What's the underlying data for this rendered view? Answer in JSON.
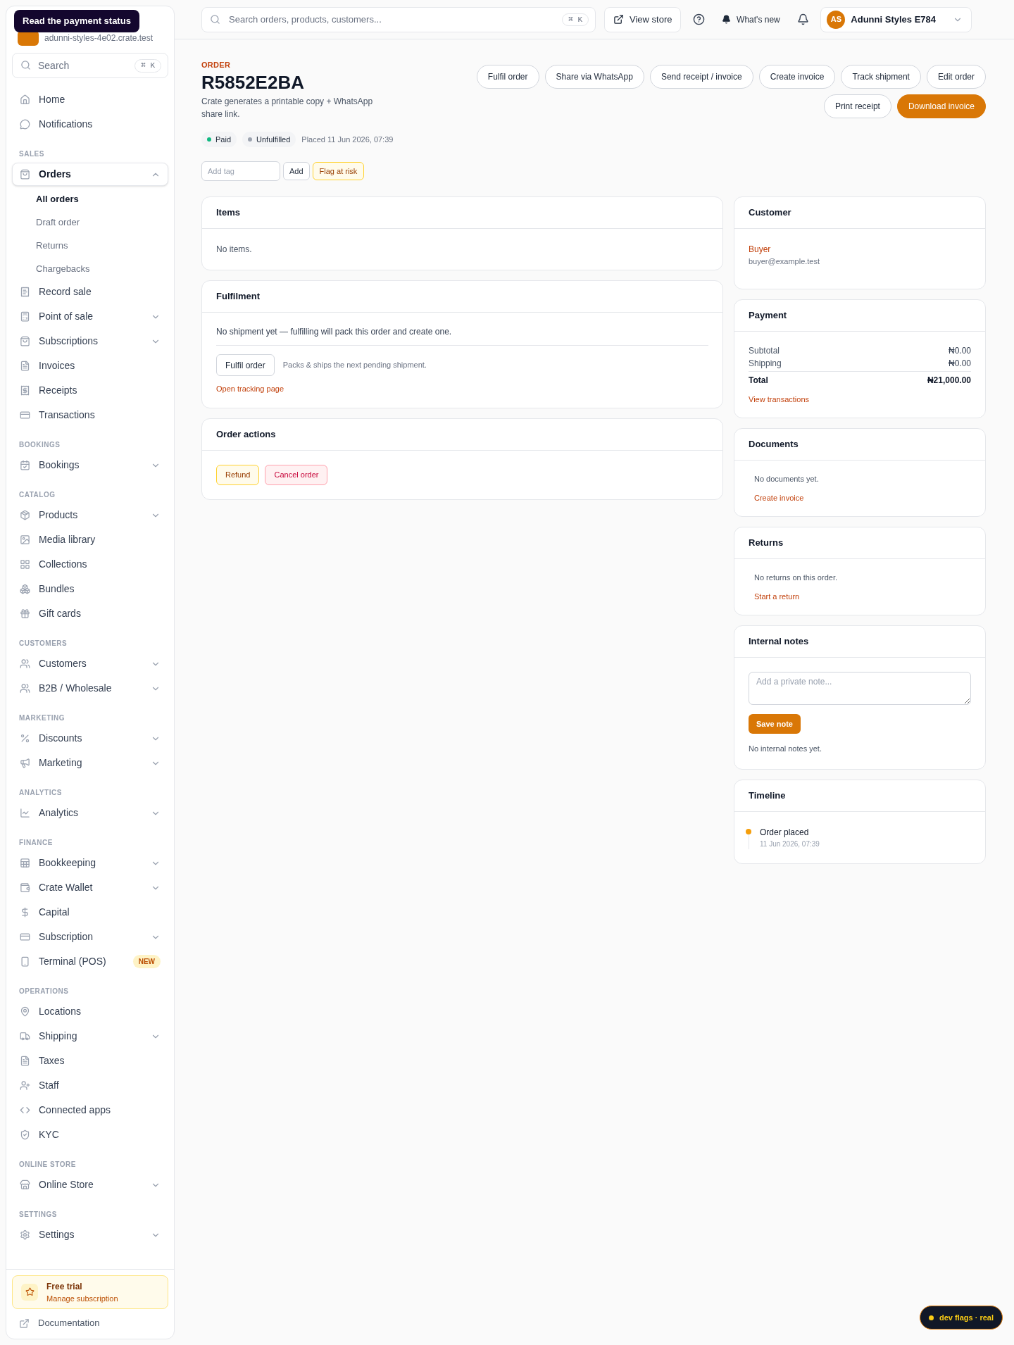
{
  "tooltip": {
    "text": "Read the payment status"
  },
  "sidebar": {
    "store_domain": "adunni-styles-4e02.crate.test",
    "search": {
      "placeholder": "Search",
      "shortcut": "⌘ K"
    },
    "sections": [
      {
        "items": [
          {
            "label": "Home",
            "selected": false
          },
          {
            "label": "Notifications",
            "selected": false
          }
        ]
      },
      {
        "label": "SALES",
        "items": [
          {
            "label": "Orders",
            "selected": true,
            "expanded": true,
            "children": [
              {
                "label": "All orders",
                "selected": true
              },
              {
                "label": "Draft order",
                "selected": false
              },
              {
                "label": "Returns",
                "selected": false
              },
              {
                "label": "Chargebacks",
                "selected": false
              }
            ]
          },
          {
            "label": "Record sale",
            "selected": false
          },
          {
            "label": "Point of sale",
            "selected": false,
            "expanded": false
          },
          {
            "label": "Subscriptions",
            "selected": false,
            "expanded": false
          },
          {
            "label": "Invoices",
            "selected": false
          },
          {
            "label": "Receipts",
            "selected": false
          },
          {
            "label": "Transactions",
            "selected": false
          }
        ]
      },
      {
        "label": "BOOKINGS",
        "items": [
          {
            "label": "Bookings",
            "selected": false,
            "expanded": false
          }
        ]
      },
      {
        "label": "CATALOG",
        "items": [
          {
            "label": "Products",
            "selected": false,
            "expanded": false
          },
          {
            "label": "Media library",
            "selected": false
          },
          {
            "label": "Collections",
            "selected": false
          },
          {
            "label": "Bundles",
            "selected": false
          },
          {
            "label": "Gift cards",
            "selected": false
          }
        ]
      },
      {
        "label": "CUSTOMERS",
        "items": [
          {
            "label": "Customers",
            "selected": false,
            "expanded": false
          },
          {
            "label": "B2B / Wholesale",
            "selected": false,
            "expanded": false
          }
        ]
      },
      {
        "label": "MARKETING",
        "items": [
          {
            "label": "Discounts",
            "selected": false,
            "expanded": false
          },
          {
            "label": "Marketing",
            "selected": false,
            "expanded": false
          }
        ]
      },
      {
        "label": "ANALYTICS",
        "items": [
          {
            "label": "Analytics",
            "selected": false,
            "expanded": false
          }
        ]
      },
      {
        "label": "FINANCE",
        "items": [
          {
            "label": "Bookkeeping",
            "selected": false,
            "expanded": false
          },
          {
            "label": "Crate Wallet",
            "selected": false,
            "expanded": false
          },
          {
            "label": "Capital",
            "selected": false
          },
          {
            "label": "Subscription",
            "selected": false,
            "expanded": false
          },
          {
            "label": "Terminal (POS)",
            "selected": false,
            "badge": "NEW"
          }
        ]
      },
      {
        "label": "OPERATIONS",
        "items": [
          {
            "label": "Locations",
            "selected": false
          },
          {
            "label": "Shipping",
            "selected": false,
            "expanded": false
          },
          {
            "label": "Taxes",
            "selected": false
          },
          {
            "label": "Staff",
            "selected": false
          },
          {
            "label": "Connected apps",
            "selected": false
          },
          {
            "label": "KYC",
            "selected": false
          }
        ]
      },
      {
        "label": "ONLINE STORE",
        "items": [
          {
            "label": "Online Store",
            "selected": false,
            "expanded": false
          }
        ]
      },
      {
        "label": "SETTINGS",
        "items": [
          {
            "label": "Settings",
            "selected": false,
            "expanded": false
          }
        ]
      }
    ],
    "trial": {
      "title": "Free trial",
      "subtitle": "Manage subscription"
    },
    "footer_link": "Documentation"
  },
  "topbar": {
    "search": {
      "placeholder": "Search orders, products, customers...",
      "shortcut": "⌘ K"
    },
    "view_store": "View store",
    "whats_new": "What's new",
    "account": {
      "initials": "AS",
      "name": "Adunni Styles E784"
    }
  },
  "header": {
    "eyebrow": "ORDER",
    "title": "R5852E2BA",
    "description": "Crate generates a printable copy + WhatsApp share link.",
    "action_rows": [
      [
        {
          "label": "Fulfil order",
          "kind": "outline"
        },
        {
          "label": "Share via WhatsApp",
          "kind": "outline"
        },
        {
          "label": "Send receipt / invoice",
          "kind": "outline"
        },
        {
          "label": "Create invoice",
          "kind": "outline"
        },
        {
          "label": "Track shipment",
          "kind": "outline"
        },
        {
          "label": "Edit order",
          "kind": "outline"
        }
      ],
      [
        {
          "label": "Print receipt",
          "kind": "outline"
        },
        {
          "label": "Download invoice",
          "kind": "primary"
        }
      ]
    ],
    "badges": [
      {
        "label": "Paid",
        "color": "#10b981"
      },
      {
        "label": "Unfulfilled",
        "color": "#9ca3af"
      }
    ],
    "placed": "Placed 11 Jun 2026, 07:39",
    "tag_input": {
      "placeholder": "Add tag"
    },
    "add_button": "Add",
    "flag_button": "Flag at risk"
  },
  "items_card": {
    "title": "Items",
    "empty": "No items."
  },
  "fulfilment": {
    "title": "Fulfilment",
    "message": "No shipment yet — fulfilling will pack this order and create one.",
    "button": "Fulfil order",
    "hint": "Packs & ships the next pending shipment.",
    "link": "Open tracking page"
  },
  "order_actions": {
    "title": "Order actions",
    "buttons": [
      {
        "label": "Refund",
        "kind": "warning"
      },
      {
        "label": "Cancel order",
        "kind": "danger"
      }
    ]
  },
  "customer": {
    "title": "Customer",
    "name": "Buyer",
    "email": "buyer@example.test"
  },
  "payment": {
    "title": "Payment",
    "rows": [
      {
        "label": "Subtotal",
        "value": "₦0.00",
        "kind": "line"
      },
      {
        "label": "Shipping",
        "value": "₦0.00",
        "kind": "line"
      },
      {
        "label": "Total",
        "value": "₦21,000.00",
        "kind": "total"
      }
    ],
    "link": "View transactions"
  },
  "documents": {
    "title": "Documents",
    "empty": "No documents yet.",
    "link": "Create invoice"
  },
  "returns": {
    "title": "Returns",
    "empty": "No returns on this order.",
    "link": "Start a return"
  },
  "notes": {
    "title": "Internal notes",
    "placeholder": "Add a private note...",
    "button": "Save note",
    "empty": "No internal notes yet."
  },
  "timeline": {
    "title": "Timeline",
    "events": [
      {
        "title": "Order placed",
        "time": "11 Jun 2026, 07:39",
        "color": "#f59e0b"
      }
    ]
  },
  "dev_flags": {
    "label": "dev flags · real",
    "color": "#facc15"
  }
}
